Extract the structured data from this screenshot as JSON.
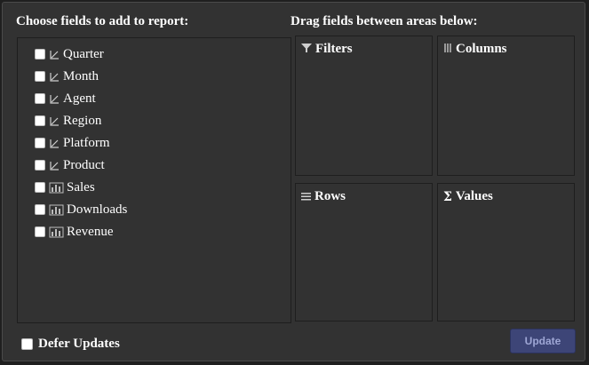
{
  "field_list": {
    "title": "Choose fields to add to report:",
    "fields": [
      {
        "label": "Quarter",
        "type": "dimension",
        "icon": "dimension-icon",
        "checked": false
      },
      {
        "label": "Month",
        "type": "dimension",
        "icon": "dimension-icon",
        "checked": false
      },
      {
        "label": "Agent",
        "type": "dimension",
        "icon": "dimension-icon",
        "checked": false
      },
      {
        "label": "Region",
        "type": "dimension",
        "icon": "dimension-icon",
        "checked": false
      },
      {
        "label": "Platform",
        "type": "dimension",
        "icon": "dimension-icon",
        "checked": false
      },
      {
        "label": "Product",
        "type": "dimension",
        "icon": "dimension-icon",
        "checked": false
      },
      {
        "label": "Sales",
        "type": "measure",
        "icon": "measure-icon",
        "checked": false
      },
      {
        "label": "Downloads",
        "type": "measure",
        "icon": "measure-icon",
        "checked": false
      },
      {
        "label": "Revenue",
        "type": "measure",
        "icon": "measure-icon",
        "checked": false
      }
    ]
  },
  "areas": {
    "title": "Drag fields between areas below:",
    "filters": {
      "label": "Filters",
      "icon": "filter-icon"
    },
    "columns": {
      "label": "Columns",
      "icon": "columns-icon"
    },
    "rows": {
      "label": "Rows",
      "icon": "rows-icon"
    },
    "values": {
      "label": "Values",
      "icon": "sigma-icon"
    }
  },
  "footer": {
    "defer_label": "Defer Updates",
    "defer_checked": false,
    "update_label": "Update"
  },
  "colors": {
    "background": "#323232",
    "border": "#1e1e1e",
    "update_button": "#3d4577",
    "update_text": "#9ea6d4"
  }
}
